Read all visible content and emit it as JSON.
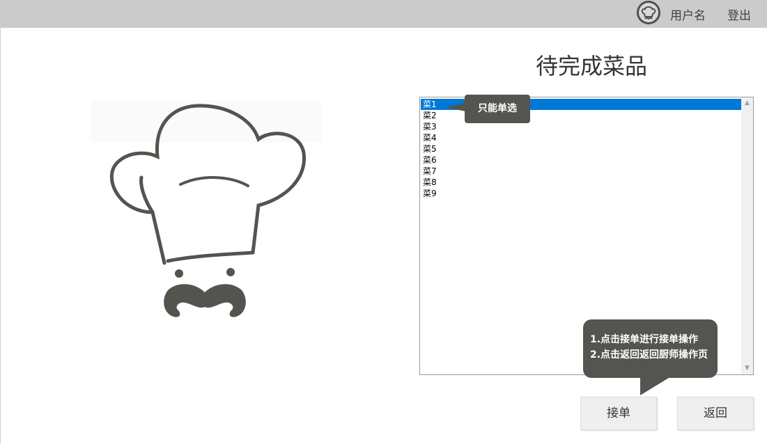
{
  "header": {
    "username": "用户名",
    "logout_label": "登出",
    "avatar_icon": "chef-avatar-icon"
  },
  "main": {
    "title": "待完成菜品",
    "dishes": [
      "菜1",
      "菜2",
      "菜3",
      "菜4",
      "菜5",
      "菜6",
      "菜7",
      "菜8",
      "菜9"
    ],
    "selected_index": 0
  },
  "tooltips": {
    "single_select": "只能单选",
    "instruction_line1": "1.点击接单进行接单操作",
    "instruction_line2": "2.点击返回返回厨师操作页"
  },
  "buttons": {
    "accept_label": "接单",
    "back_label": "返回"
  },
  "colors": {
    "topbar": "#cbcbcb",
    "selection": "#0078d7",
    "tooltip": "#545450"
  }
}
